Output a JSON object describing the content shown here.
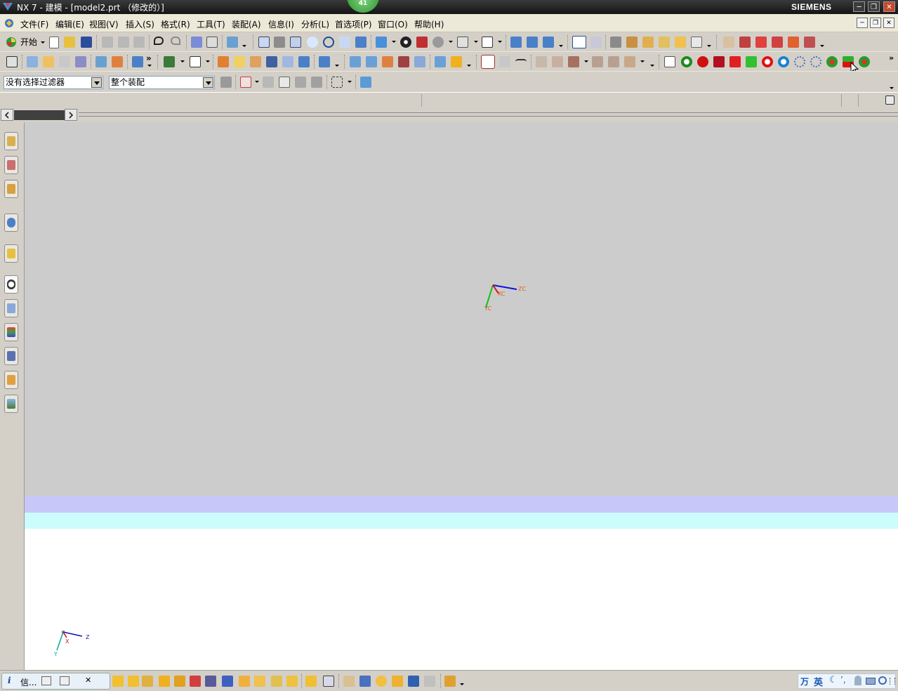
{
  "window": {
    "title": "NX 7 - 建模 - [model2.prt （修改的）]",
    "brand": "SIEMENS",
    "badge": "41"
  },
  "menubar": {
    "items": [
      "文件(F)",
      "编辑(E)",
      "视图(V)",
      "插入(S)",
      "格式(R)",
      "工具(T)",
      "装配(A)",
      "信息(I)",
      "分析(L)",
      "首选项(P)",
      "窗口(O)",
      "帮助(H)"
    ]
  },
  "toolbar": {
    "start_label": "开始",
    "more_glyph": "»"
  },
  "selection_bar": {
    "filter_value": "没有选择过滤器",
    "scope_value": "整个装配"
  },
  "graphics": {
    "wcs_labels": {
      "x": "XC",
      "y": "YC",
      "z": "ZC"
    },
    "triad_labels": {
      "x": "X",
      "y": "Y",
      "z": "Z"
    }
  },
  "bottom": {
    "info_tab_label": "信..."
  },
  "ime": {
    "mode_label": "英",
    "logo": "万"
  },
  "colors": {
    "band_lavender": "#c8c8f8",
    "band_cyan": "#ccfcfc",
    "viewport": "#cccccc"
  }
}
